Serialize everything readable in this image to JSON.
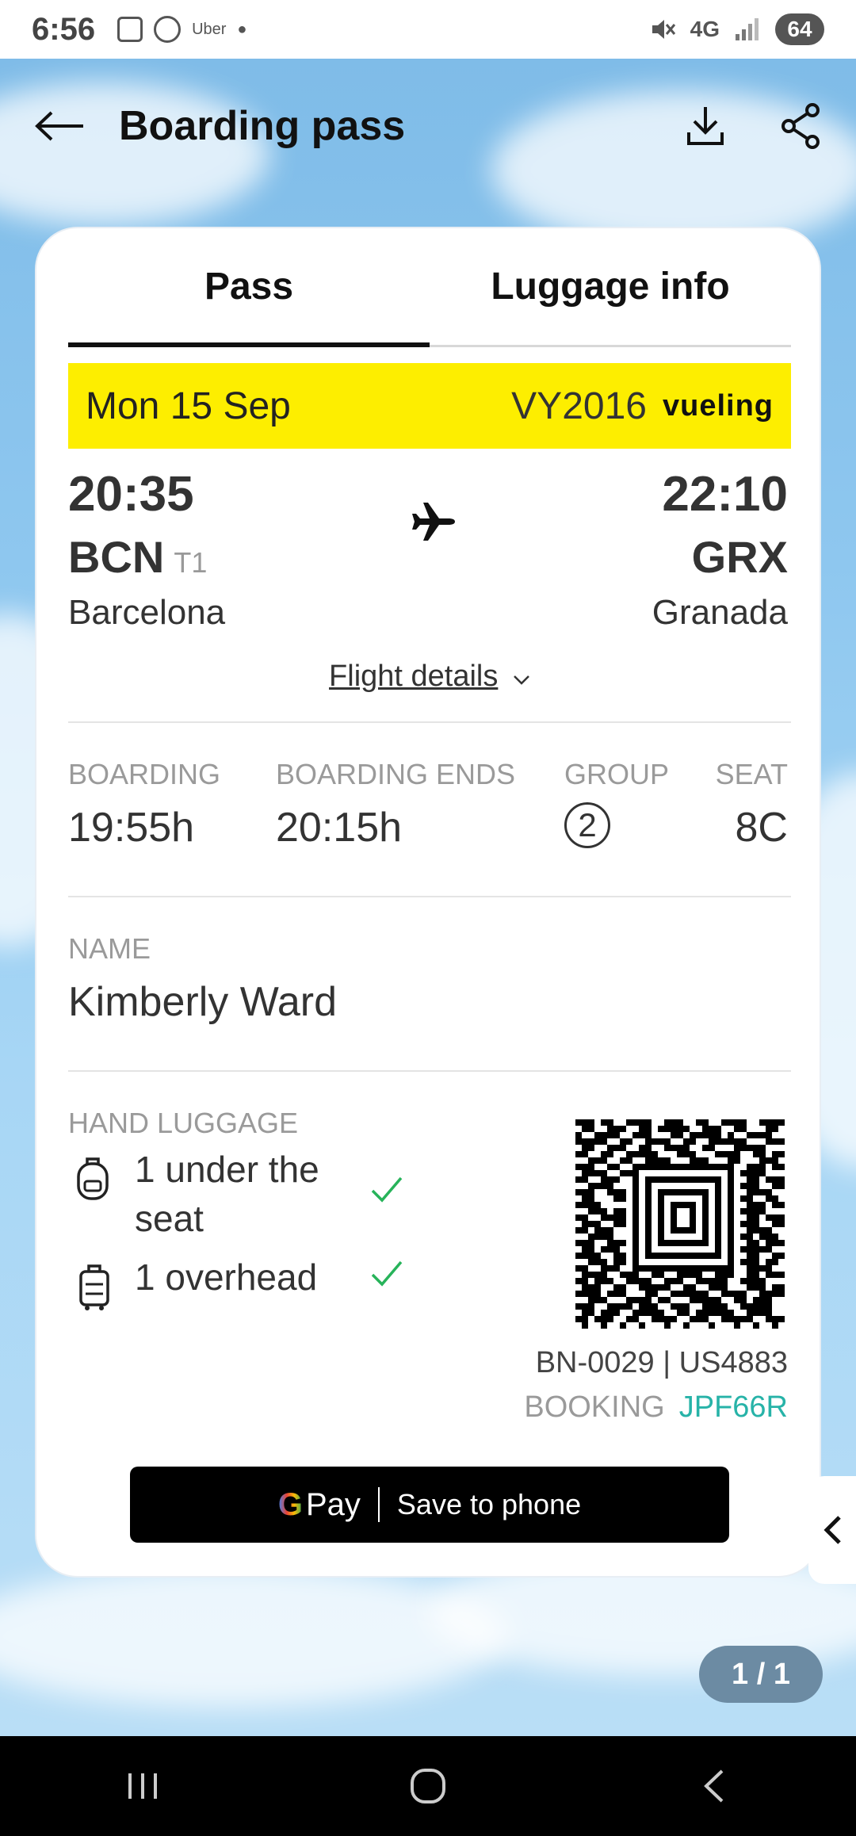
{
  "status_bar": {
    "time": "6:56",
    "app_label": "Uber",
    "network": "4G",
    "battery": "64"
  },
  "header": {
    "title": "Boarding pass"
  },
  "tabs": [
    {
      "label": "Pass",
      "active": true
    },
    {
      "label": "Luggage info",
      "active": false
    }
  ],
  "flight": {
    "date": "Mon 15 Sep",
    "number": "VY2016",
    "airline": "vueling",
    "departure": {
      "time": "20:35",
      "code": "BCN",
      "terminal": "T1",
      "city": "Barcelona"
    },
    "arrival": {
      "time": "22:10",
      "code": "GRX",
      "city": "Granada"
    },
    "details_link": "Flight details"
  },
  "boarding": {
    "boarding_label": "BOARDING",
    "boarding_time": "19:55h",
    "ends_label": "BOARDING ENDS",
    "ends_time": "20:15h",
    "group_label": "GROUP",
    "group_value": "2",
    "seat_label": "SEAT",
    "seat_value": "8C"
  },
  "passenger": {
    "name_label": "NAME",
    "name": "Kimberly Ward"
  },
  "luggage": {
    "label": "HAND LUGGAGE",
    "items": [
      {
        "text_line1": "1 under the",
        "text_line2": "seat",
        "icon": "backpack-icon"
      },
      {
        "text_line1": "1 overhead",
        "icon": "trolley-icon"
      }
    ]
  },
  "reference": {
    "ref_text": "BN-0029 | US4883",
    "booking_label": "BOOKING",
    "booking_code": "JPF66R"
  },
  "gpay_button": {
    "g": "G",
    "pay": "Pay",
    "label": "Save to phone"
  },
  "pager": {
    "text": "1 / 1"
  },
  "colors": {
    "accent_yellow": "#fdee00",
    "booking_teal": "#27b3a8",
    "pager_bg": "#6c8ba3"
  }
}
